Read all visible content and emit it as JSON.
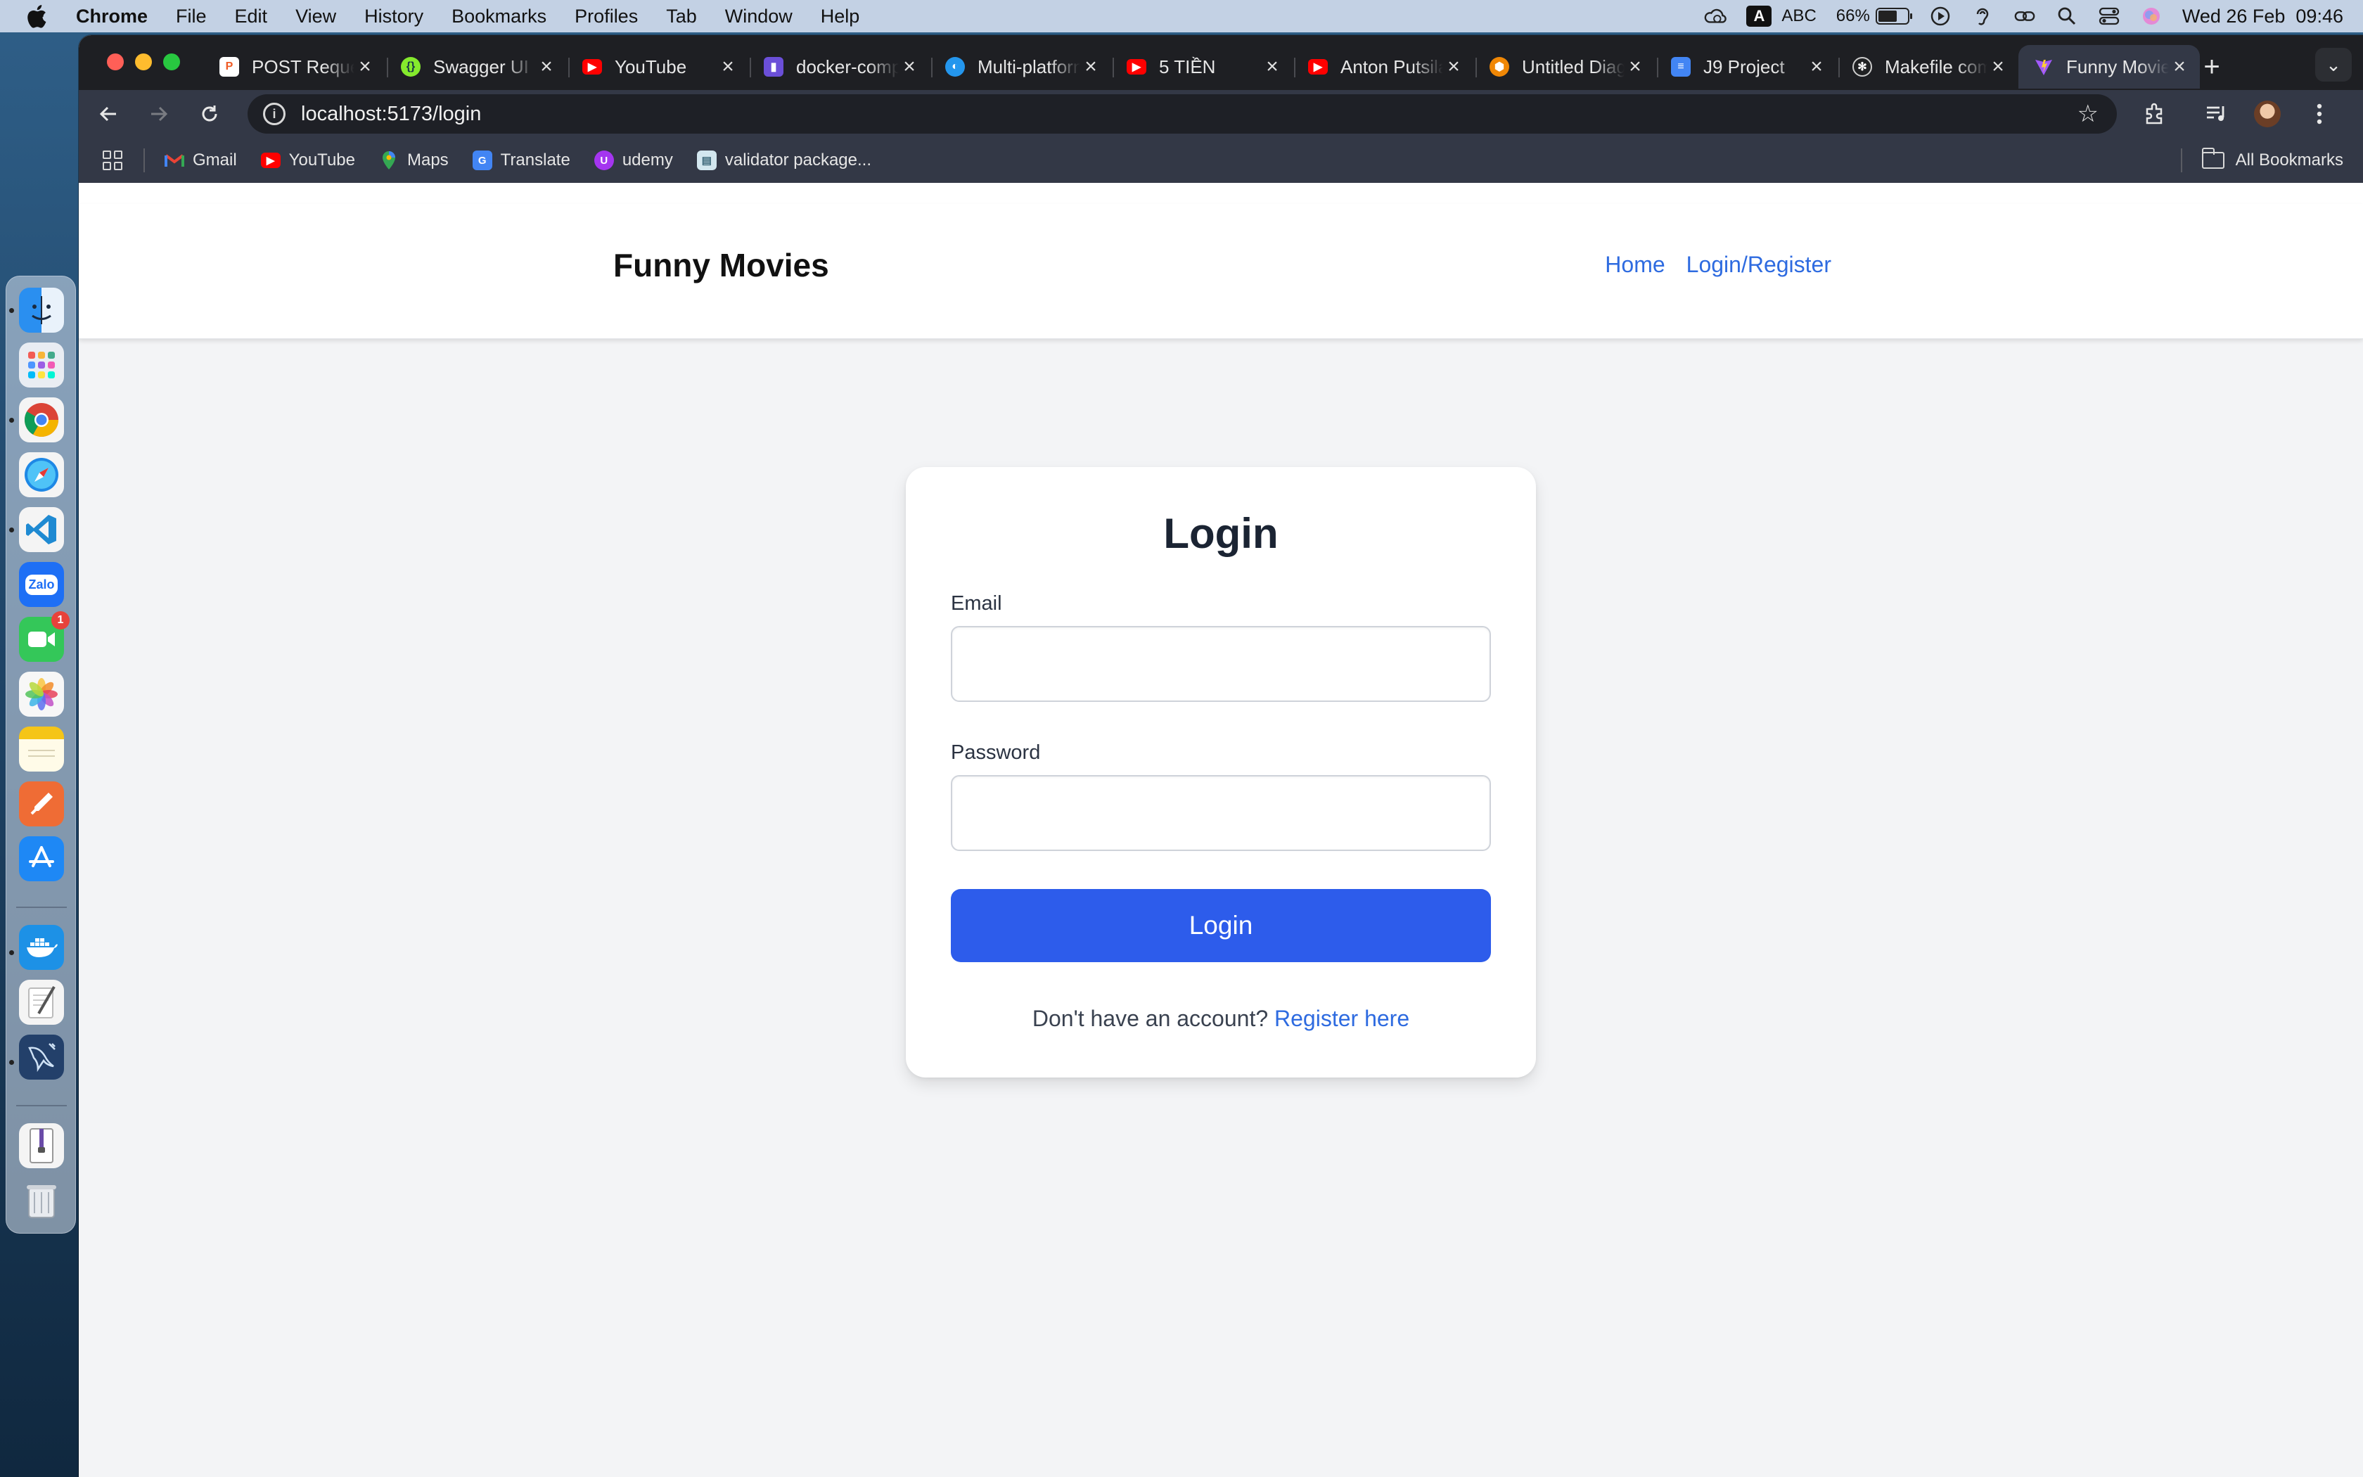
{
  "menubar": {
    "apple": "",
    "app_name": "Chrome",
    "items": [
      "File",
      "Edit",
      "View",
      "History",
      "Bookmarks",
      "Profiles",
      "Tab",
      "Window",
      "Help"
    ],
    "input_source_letter": "A",
    "input_source": "ABC",
    "battery_percent": "66%",
    "battery_level": 0.66,
    "datetime": "Wed 26 Feb  09:46"
  },
  "tabs": [
    {
      "title": "POST Request",
      "favicon": "postman-icon",
      "color": "#ffffff"
    },
    {
      "title": "Swagger UI",
      "favicon": "swagger-icon",
      "color": "#85ea2d"
    },
    {
      "title": "YouTube",
      "favicon": "youtube-icon",
      "color": "#ff0000"
    },
    {
      "title": "docker-compose",
      "favicon": "docs-icon",
      "color": "#6b4fd8"
    },
    {
      "title": "Multi-platform",
      "favicon": "docker-icon",
      "color": "#2496ed"
    },
    {
      "title": "5 TIỀN",
      "favicon": "youtube-icon",
      "color": "#ff0000"
    },
    {
      "title": "Anton Putsila",
      "favicon": "youtube-icon",
      "color": "#ff0000"
    },
    {
      "title": "Untitled Diagram",
      "favicon": "drawio-icon",
      "color": "#f08705"
    },
    {
      "title": "J9 Project",
      "favicon": "google-docs-icon",
      "color": "#4285f4"
    },
    {
      "title": "Makefile commands",
      "favicon": "openai-icon",
      "color": "#202123"
    },
    {
      "title": "Funny Movies",
      "favicon": "vite-icon",
      "color": "#a259ff",
      "active": true
    }
  ],
  "toolbar": {
    "url": "localhost:5173/login"
  },
  "bookmarks": [
    {
      "label": "Gmail",
      "icon": "gmail-icon",
      "color": "#ea4335"
    },
    {
      "label": "YouTube",
      "icon": "youtube-icon",
      "color": "#ff0000"
    },
    {
      "label": "Maps",
      "icon": "maps-icon",
      "color": "#34a853"
    },
    {
      "label": "Translate",
      "icon": "translate-icon",
      "color": "#4285f4"
    },
    {
      "label": "udemy",
      "icon": "udemy-icon",
      "color": "#a435f0"
    },
    {
      "label": "validator package...",
      "icon": "npm-icon",
      "color": "#7fb3c8"
    }
  ],
  "all_bookmarks": "All Bookmarks",
  "site": {
    "brand": "Funny Movies",
    "nav": {
      "home": "Home",
      "login_register": "Login/Register"
    }
  },
  "login": {
    "title": "Login",
    "email_label": "Email",
    "email_value": "",
    "password_label": "Password",
    "password_value": "",
    "submit_label": "Login",
    "register_prompt": "Don't have an account?",
    "register_link": "Register here"
  },
  "dock": {
    "apps": [
      "finder-icon",
      "launchpad-icon",
      "chrome-icon",
      "safari-icon",
      "vscode-icon",
      "zalo-icon",
      "facetime-icon",
      "photos-icon",
      "notes-icon",
      "postman-icon",
      "app-store-icon",
      "docker-icon",
      "textedit-icon",
      "mysql-workbench-icon",
      "zip-archive-icon",
      "trash-icon"
    ],
    "zalo_label": "Zalo",
    "facetime_badge": "1"
  }
}
